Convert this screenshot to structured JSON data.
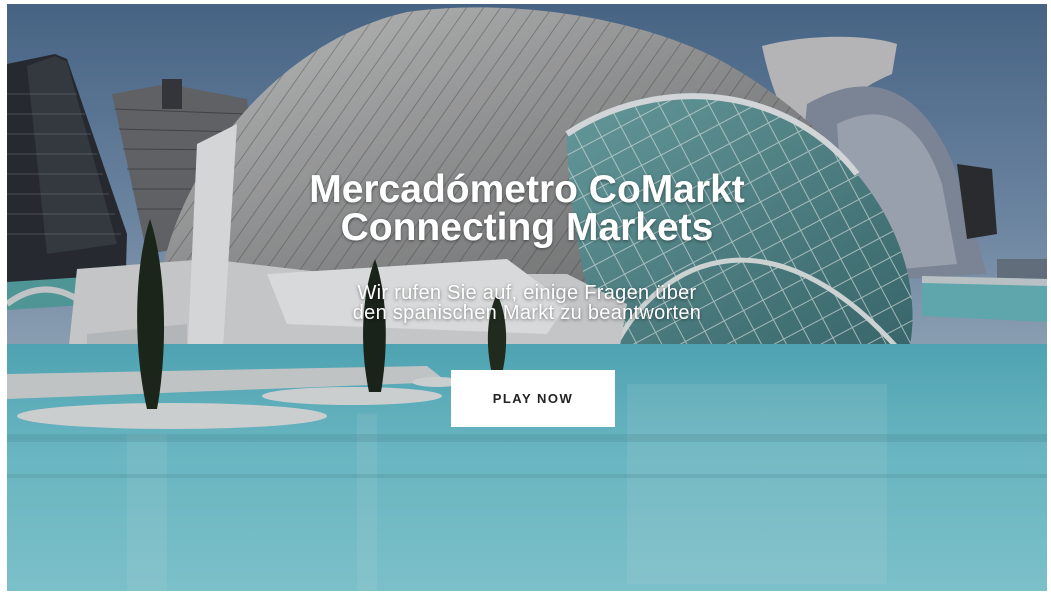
{
  "hero": {
    "title_line1": "Mercadómetro CoMarkt",
    "title_line2": "Connecting Markets",
    "subtitle_line1": "Wir rufen Sie auf, einige Fragen über",
    "subtitle_line2": "den spanischen Markt zu beantworten",
    "cta_label": "PLAY NOW",
    "background": "photo-city-of-arts-and-sciences-valencia"
  },
  "colors": {
    "sky": "#5f7fa0",
    "water": "#6fc6d3",
    "text": "#ffffff",
    "button_bg": "#ffffff",
    "button_text": "#222222"
  }
}
